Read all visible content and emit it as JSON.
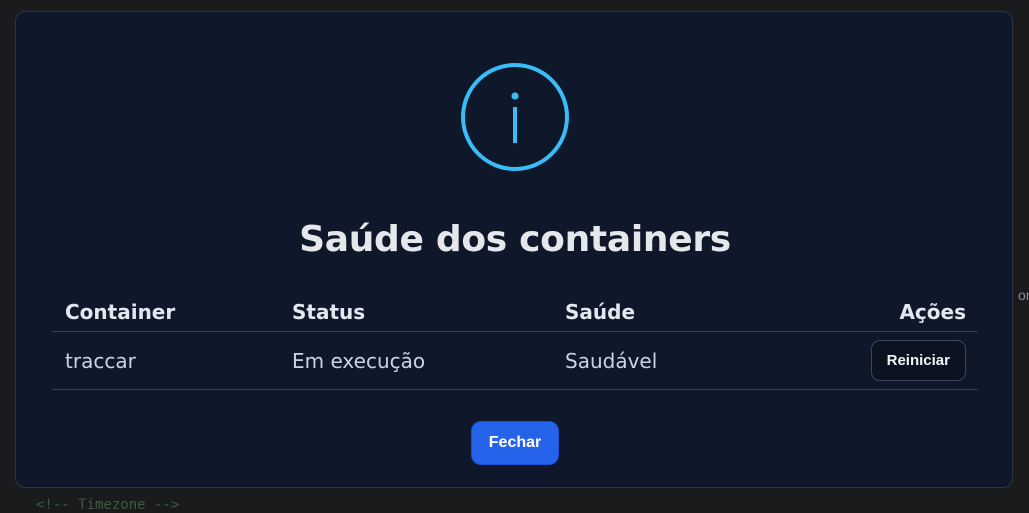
{
  "background": {
    "code_fragment": "<!-- Timezone -->",
    "edge_text": "or"
  },
  "modal": {
    "icon": "info-icon",
    "icon_color": "#38bdf8",
    "title": "Saúde dos containers",
    "table": {
      "headers": [
        "Container",
        "Status",
        "Saúde",
        "Ações"
      ],
      "rows": [
        {
          "container": "traccar",
          "status": "Em execução",
          "health": "Saudável",
          "action_label": "Reiniciar"
        }
      ]
    },
    "close_label": "Fechar",
    "accent_color": "#2563eb"
  }
}
